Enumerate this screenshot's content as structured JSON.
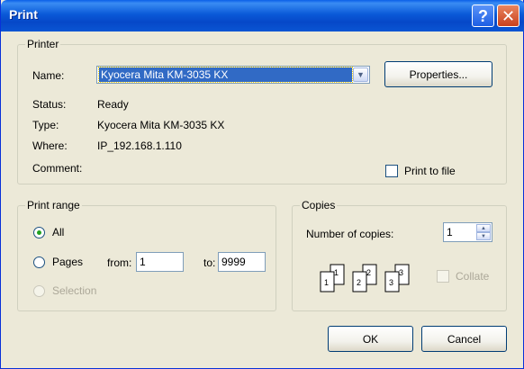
{
  "window": {
    "title": "Print",
    "help_glyph": "?",
    "close_glyph": "✕"
  },
  "printer": {
    "legend": "Printer",
    "name_label": "Name:",
    "name_value": "Kyocera Mita KM-3035 KX",
    "properties_label": "Properties...",
    "status_label": "Status:",
    "status_value": "Ready",
    "type_label": "Type:",
    "type_value": "Kyocera Mita KM-3035 KX",
    "where_label": "Where:",
    "where_value": "IP_192.168.1.110",
    "comment_label": "Comment:",
    "comment_value": "",
    "print_to_file_label": "Print to file",
    "print_to_file_checked": false
  },
  "print_range": {
    "legend": "Print range",
    "all_label": "All",
    "pages_label": "Pages",
    "selection_label": "Selection",
    "selected": "All",
    "from_label": "from:",
    "from_value": "1",
    "to_label": "to:",
    "to_value": "9999"
  },
  "copies": {
    "legend": "Copies",
    "number_label": "Number of copies:",
    "number_value": "1",
    "collate_label": "Collate",
    "collate_checked": false,
    "collate_enabled": false,
    "page_numbers": [
      "1",
      "1",
      "2",
      "2",
      "3",
      "3"
    ]
  },
  "buttons": {
    "ok_label": "OK",
    "cancel_label": "Cancel"
  },
  "colors": {
    "titlebar": "#0A5AD8",
    "selection": "#316AC5",
    "dialog_bg": "#ECE9D8"
  }
}
